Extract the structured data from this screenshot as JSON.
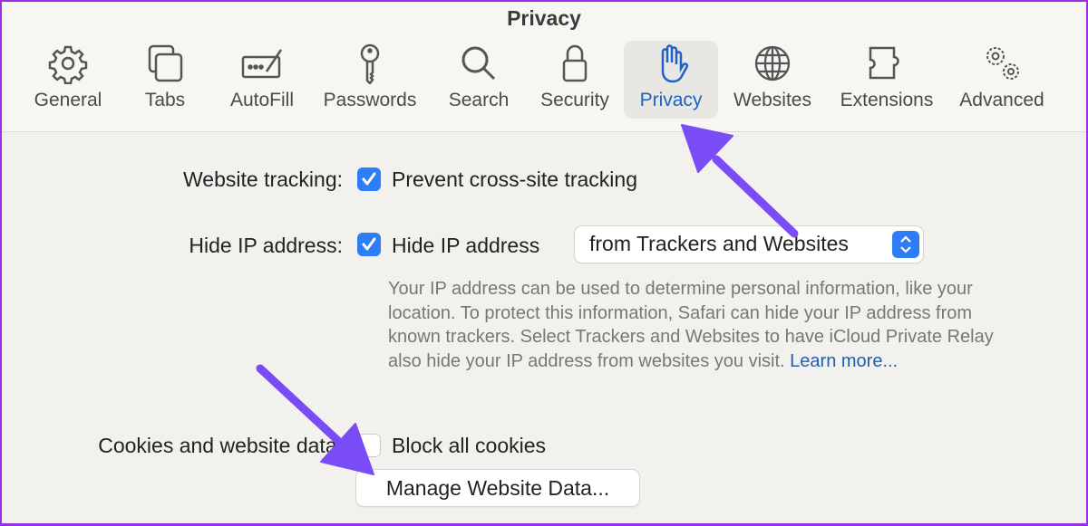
{
  "window": {
    "title": "Privacy"
  },
  "tabs": [
    {
      "label": "General",
      "icon": "gear-icon"
    },
    {
      "label": "Tabs",
      "icon": "tabs-icon"
    },
    {
      "label": "AutoFill",
      "icon": "autofill-icon"
    },
    {
      "label": "Passwords",
      "icon": "key-icon"
    },
    {
      "label": "Search",
      "icon": "search-icon"
    },
    {
      "label": "Security",
      "icon": "lock-icon"
    },
    {
      "label": "Privacy",
      "icon": "hand-icon",
      "active": true
    },
    {
      "label": "Websites",
      "icon": "globe-icon"
    },
    {
      "label": "Extensions",
      "icon": "puzzle-icon"
    },
    {
      "label": "Advanced",
      "icon": "gears-icon"
    }
  ],
  "settings": {
    "tracking": {
      "label": "Website tracking:",
      "checkbox": "Prevent cross-site tracking",
      "checked": true
    },
    "hide_ip": {
      "label": "Hide IP address:",
      "checkbox": "Hide IP address",
      "checked": true,
      "popup_value": "from Trackers and Websites",
      "description": "Your IP address can be used to determine personal information, like your location. To protect this information, Safari can hide your IP address from known trackers. Select Trackers and Websites to have iCloud Private Relay also hide your IP address from websites you visit.",
      "learn_more": "Learn more..."
    },
    "cookies": {
      "label": "Cookies and website data:",
      "checkbox": "Block all cookies",
      "checked": false
    },
    "manage_button": "Manage Website Data..."
  },
  "colors": {
    "accent": "#2e7cf6",
    "active_tab_text": "#1f62c4",
    "annotation_arrow": "#7a4cf5",
    "frame": "#9b30e0"
  }
}
